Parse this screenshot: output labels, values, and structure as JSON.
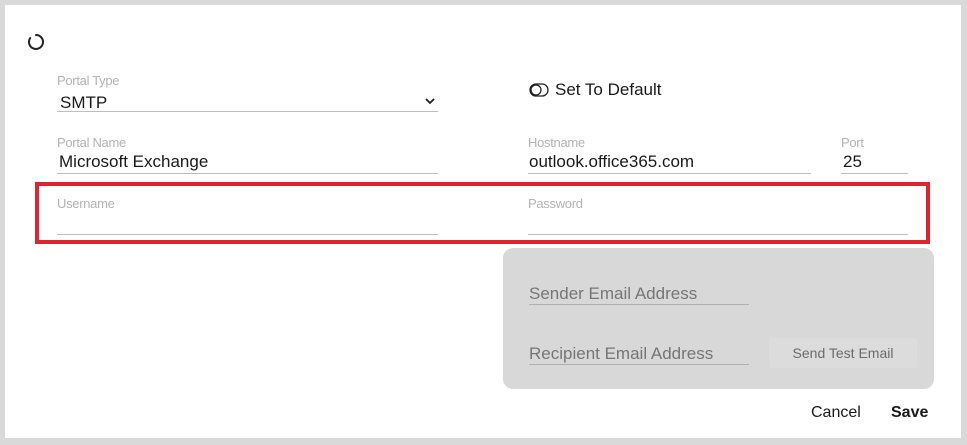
{
  "icons": {
    "loading": "loading-spinner-icon",
    "toggle": "toggle-icon",
    "dropdown": "chevron-down-icon"
  },
  "portal_type": {
    "label": "Portal Type",
    "value": "SMTP"
  },
  "set_default": {
    "label": "Set To Default"
  },
  "portal_name": {
    "label": "Portal Name",
    "value": "Microsoft Exchange"
  },
  "hostname": {
    "label": "Hostname",
    "value": "outlook.office365.com"
  },
  "port": {
    "label": "Port",
    "value": "25"
  },
  "username": {
    "label": "Username",
    "value": ""
  },
  "password": {
    "label": "Password",
    "value": ""
  },
  "test_panel": {
    "sender_placeholder": "Sender Email Address",
    "recipient_placeholder": "Recipient Email Address",
    "send_test_label": "Send Test Email"
  },
  "actions": {
    "cancel_label": "Cancel",
    "save_label": "Save"
  },
  "colors": {
    "highlight": "#e0242f",
    "panel_bg": "#d8d8d8"
  }
}
